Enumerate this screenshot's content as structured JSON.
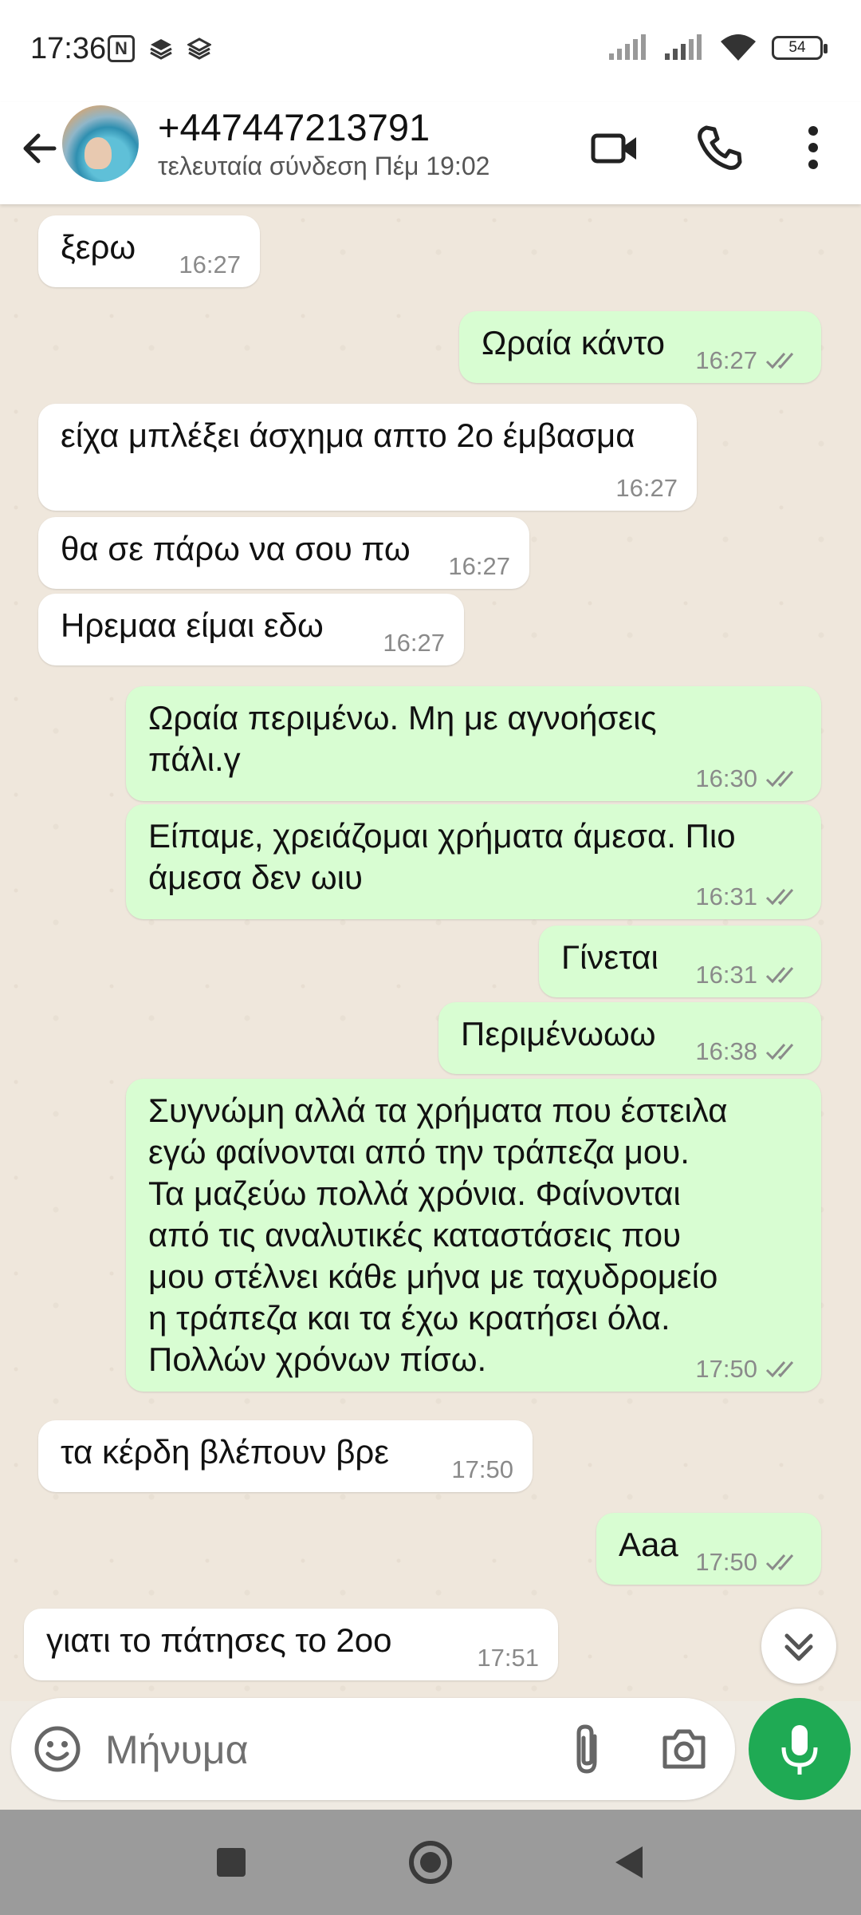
{
  "status_bar": {
    "time": "17:36",
    "nfc_label": "N",
    "battery": "54"
  },
  "header": {
    "contact": "+447447213791",
    "last_seen": "τελευταία σύνδεση Πέμ 19:02"
  },
  "messages": [
    {
      "dir": "in",
      "text": "ξερω",
      "time": "16:27"
    },
    {
      "dir": "out",
      "text": "Ωραία κάντο",
      "time": "16:27"
    },
    {
      "dir": "in",
      "text": "είχα μπλέξει άσχημα απτο 2ο έμβασμα",
      "time": "16:27"
    },
    {
      "dir": "in",
      "text": "θα σε πάρω να σου πω",
      "time": "16:27"
    },
    {
      "dir": "in",
      "text": "Ηρεμαα είμαι εδω",
      "time": "16:27"
    },
    {
      "dir": "out",
      "text": "Ωραία περιμένω. Μη με αγνοήσεις\nπάλι.γ",
      "time": "16:30"
    },
    {
      "dir": "out",
      "text": "Είπαμε, χρειάζομαι χρήματα άμεσα. Πιο\nάμεσα δεν ωιυ",
      "time": "16:31"
    },
    {
      "dir": "out",
      "text": "Γίνεται",
      "time": "16:31"
    },
    {
      "dir": "out",
      "text": "Περιμένωωω",
      "time": "16:38"
    },
    {
      "dir": "out",
      "text": "Συγνώμη αλλά τα χρήματα που έστειλα\nεγώ φαίνονται από την τράπεζα μου.\nΤα  μαζεύω πολλά χρόνια. Φαίνονται\nαπό τις αναλυτικές καταστάσεις που\nμου στέλνει κάθε μήνα με ταχυδρομείο\nη τράπεζα και τα έχω κρατήσει όλα.\nΠολλών χρόνων πίσω.",
      "time": "17:50"
    },
    {
      "dir": "in",
      "text": "τα κέρδη βλέπουν βρε",
      "time": "17:50"
    },
    {
      "dir": "out",
      "text": "Αaa",
      "time": "17:50"
    },
    {
      "dir": "in",
      "text": "γιατι το πάτησες το 2οο",
      "time": "17:51"
    }
  ],
  "input": {
    "placeholder": "Μήνυμα"
  },
  "icons": [
    "back-arrow-icon",
    "video-call-icon",
    "phone-icon",
    "more-icon",
    "emoji-icon",
    "attach-icon",
    "camera-icon",
    "mic-icon",
    "scroll-down-icon"
  ],
  "colors": {
    "outgoing_bubble": "#d8fdd2",
    "incoming_bubble": "#ffffff",
    "mic_button": "#1faa54",
    "tick_gray": "#8a8a8a"
  }
}
